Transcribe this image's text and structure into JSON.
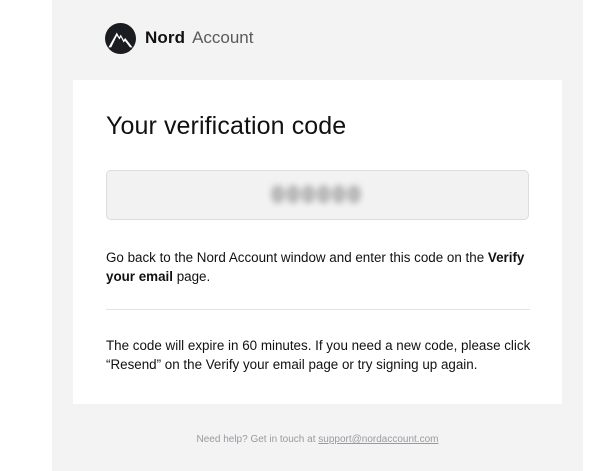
{
  "header": {
    "brand_name": "Nord",
    "brand_sub": "Account",
    "logo_icon": "nord-mountain-logo"
  },
  "card": {
    "title": "Your verification code",
    "code": "000000",
    "instruction_prefix": "Go back to the Nord Account window and enter this code on the ",
    "instruction_bold": "Verify your email",
    "instruction_suffix": " page.",
    "expiry_text": "The code will expire in 60 minutes. If you need a new code, please click “Resend” on the Verify your email page or try signing up again."
  },
  "footer": {
    "help_text": "Need help? Get in touch at ",
    "support_email": "support@nordaccount.com"
  },
  "colors": {
    "page_background": "#f3f3f4",
    "card_background": "#ffffff",
    "logo_dark": "#1a1c22"
  }
}
